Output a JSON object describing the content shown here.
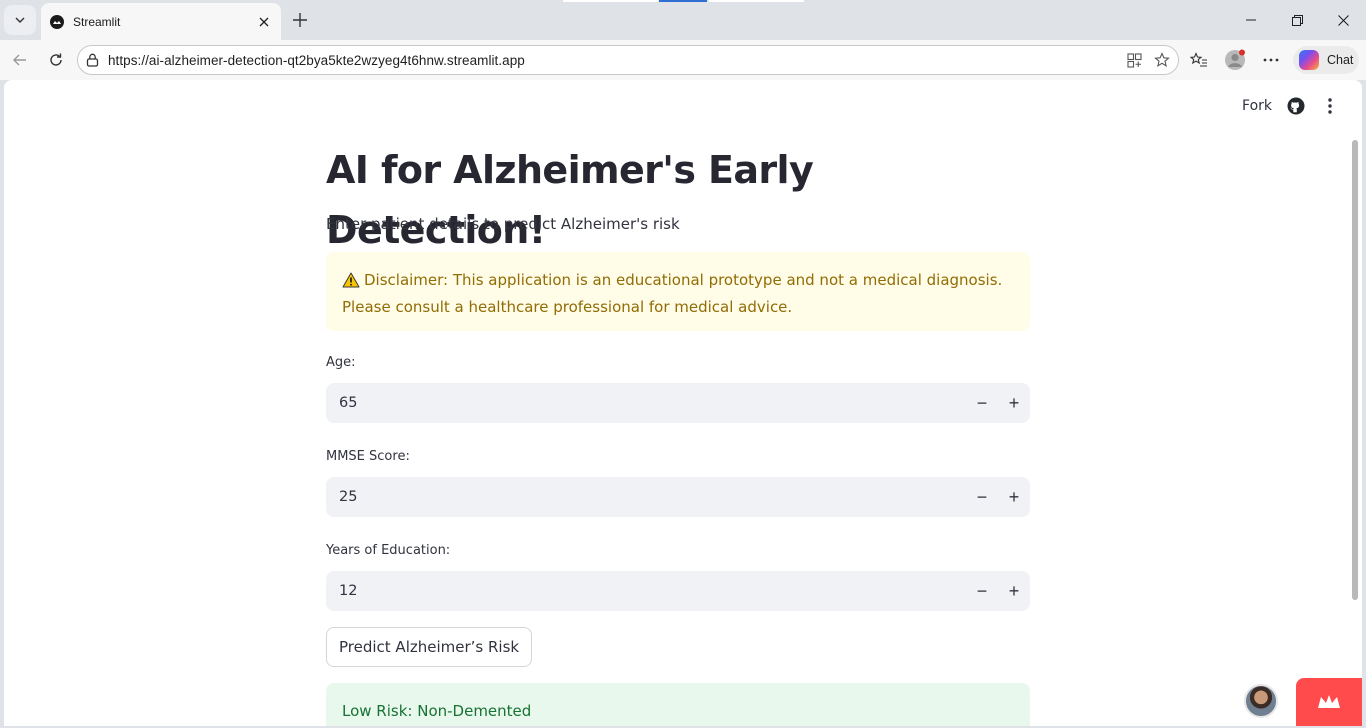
{
  "browser": {
    "tab_title": "Streamlit",
    "url": "https://ai-alzheimer-detection-qt2bya5kte2wzyeg4t6hnw.streamlit.app",
    "copilot_label": "Chat"
  },
  "header": {
    "fork_label": "Fork"
  },
  "page": {
    "title": "AI for Alzheimer's Early Detection!",
    "subtitle": "Enter patient details to predict Alzheimer's risk",
    "disclaimer": "Disclaimer: This application is an educational prototype and not a medical diagnosis. Please consult a healthcare professional for medical advice."
  },
  "fields": [
    {
      "label": "Age:",
      "value": "65"
    },
    {
      "label": "MMSE Score:",
      "value": "25"
    },
    {
      "label": "Years of Education:",
      "value": "12"
    }
  ],
  "steppers": {
    "minus": "−",
    "plus": "+"
  },
  "predict_button": "Predict Alzheimer’s Risk",
  "result": "Low Risk: Non-Demented",
  "colors": {
    "warning_bg": "#fffce7",
    "warning_text": "#926c05",
    "success_bg": "#e8f8ec",
    "success_text": "#177233",
    "streamlit_red": "#ff4b4b"
  }
}
